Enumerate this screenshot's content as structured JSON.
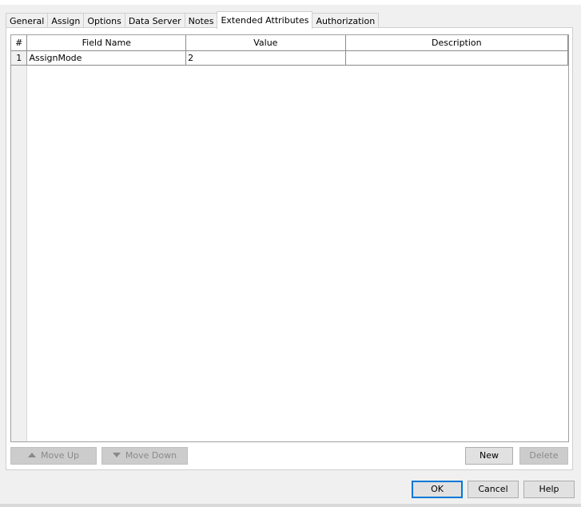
{
  "tabs": [
    {
      "label": "General"
    },
    {
      "label": "Assign"
    },
    {
      "label": "Options"
    },
    {
      "label": "Data Server"
    },
    {
      "label": "Notes"
    },
    {
      "label": "Extended Attributes"
    },
    {
      "label": "Authorization"
    }
  ],
  "active_tab": "Extended Attributes",
  "table": {
    "columns": [
      "#",
      "Field Name",
      "Value",
      "Description"
    ],
    "rows": [
      {
        "num": "1",
        "field_name": "AssignMode",
        "value": "2",
        "description": ""
      }
    ]
  },
  "panel_buttons": {
    "move_up": "Move Up",
    "move_down": "Move Down",
    "new": "New",
    "delete": "Delete"
  },
  "dialog_buttons": {
    "ok": "OK",
    "cancel": "Cancel",
    "help": "Help"
  },
  "icons": {
    "move_up": "triangle-up-icon",
    "move_down": "triangle-down-icon"
  },
  "colors": {
    "ok_focus_border": "#0078d7",
    "grid_border": "#8c8c8c"
  }
}
